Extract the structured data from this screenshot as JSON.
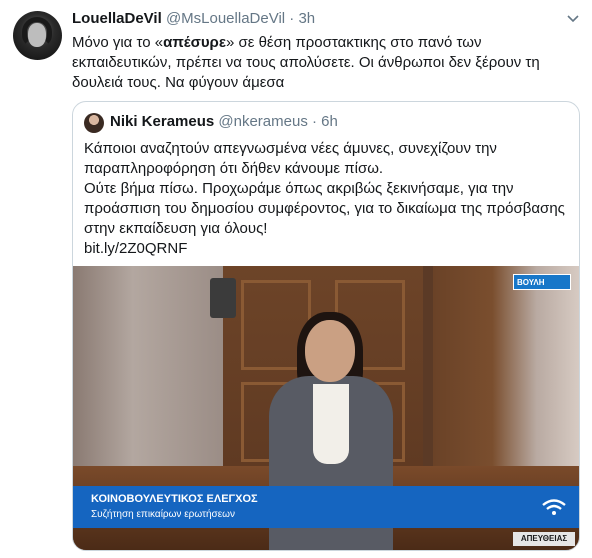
{
  "tweet": {
    "author_name": "LouellaDeVil",
    "handle": "@MsLouellaDeVil",
    "separator": "·",
    "time": "3h",
    "text_before": "Μόνο για το «",
    "text_bold": "απέσυρε",
    "text_after": "» σε θέση προστακτικης στο πανό των εκπαιδευτικών, πρέπει να τους απολύσετε. Οι άνθρωποι δεν ξέρουν τη δουλειά τους. Να φύγουν άμεσα"
  },
  "quoted": {
    "author_name": "Niki Kerameus",
    "handle": "@nkerameus",
    "separator": "·",
    "time": "6h",
    "text": "Κάποιοι αναζητούν απεγνωσμένα νέες άμυνες, συνεχίζουν την παραπληροφόρηση ότι δήθεν κάνουμε πίσω.\nΟύτε βήμα πίσω. Προχωράμε όπως ακριβώς ξεκινήσαμε, για την προάσπιση του δημοσίου συμφέροντος, για το δικαίωμα της πρόσβασης στην εκπαίδευση για όλους!\nbit.ly/2Z0QRNF"
  },
  "media": {
    "channel_logo": "ΒΟΥΛΗ",
    "lower_third_title": "ΚΟΙΝΟΒΟΥΛΕΥΤΙΚΟΣ ΕΛΕΓΧΟΣ",
    "lower_third_subtitle": "Συζήτηση επικαίρων ερωτήσεων",
    "live_label": "ΑΠΕΥΘΕΙΑΣ"
  },
  "icons": [
    "chevron-down-icon",
    "broadcast-wave-icon"
  ],
  "colors": {
    "text": "#14171a",
    "secondary": "#657786",
    "border": "#ccd6dd",
    "broadcast_blue": "#1565c0"
  }
}
